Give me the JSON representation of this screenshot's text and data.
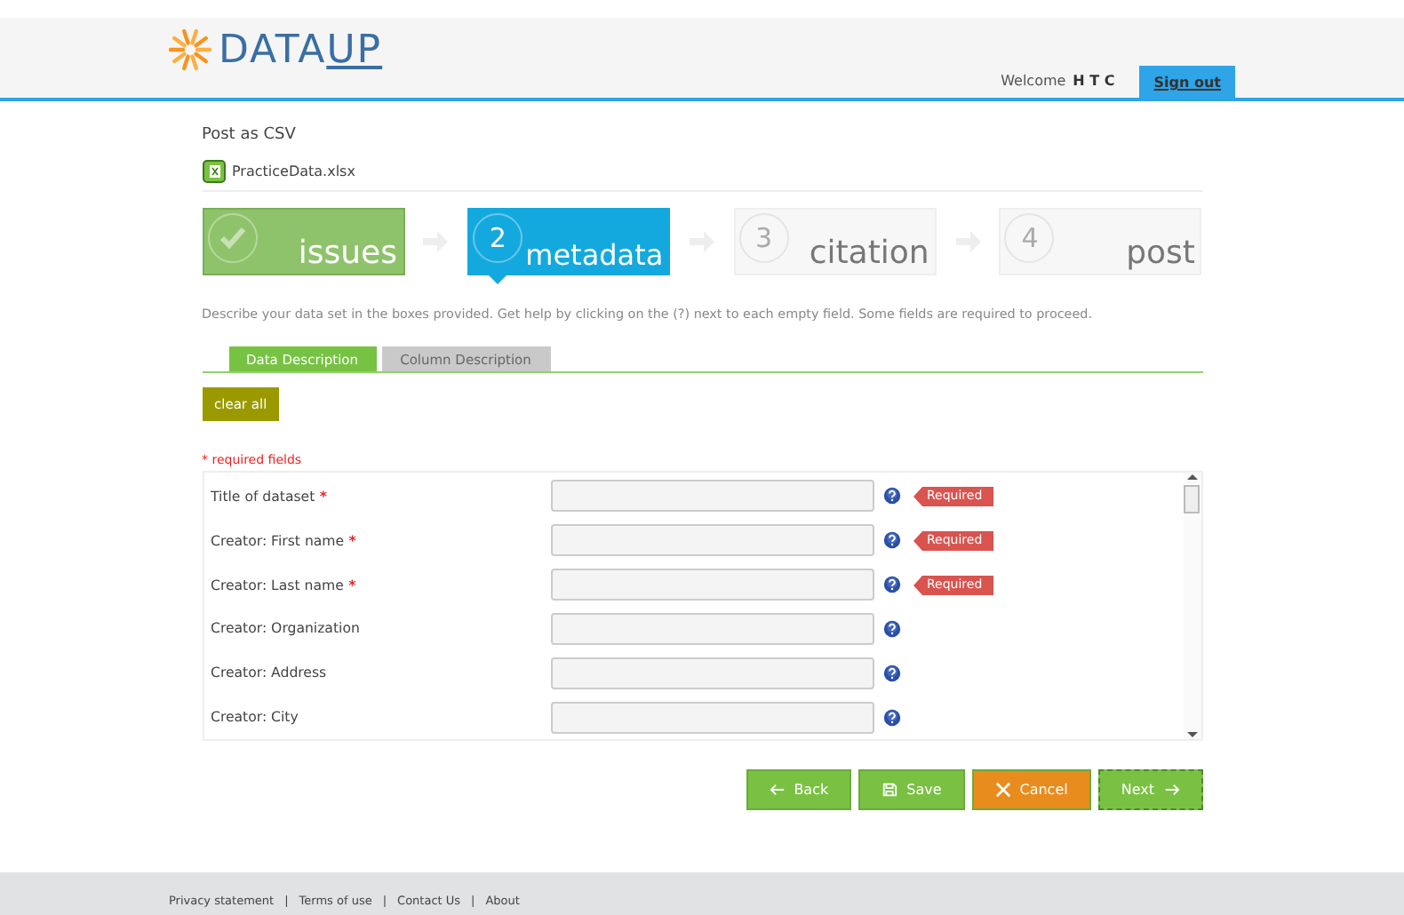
{
  "header": {
    "logo": {
      "text": "DATA",
      "accent": "UP"
    },
    "welcome": "Welcome",
    "user": "H T C",
    "sign_out": "Sign out"
  },
  "page_title": "Post as CSV",
  "file": {
    "name": "PracticeData.xlsx"
  },
  "steps": [
    {
      "label": "issues",
      "done": true,
      "selected": false
    },
    {
      "number": "2",
      "label": "metadata",
      "done": false,
      "selected": true
    },
    {
      "number": "3",
      "label": "citation",
      "done": false,
      "selected": false
    },
    {
      "number": "4",
      "label": "post",
      "done": false,
      "selected": false
    }
  ],
  "description": "Describe your data set in the boxes provided. Get help by clicking on the (?) next to each empty field. Some fields are required to proceed.",
  "tabs": [
    {
      "label": "Data Description",
      "selected": true
    },
    {
      "label": "Column Description",
      "selected": false
    }
  ],
  "clear_button": "clear all",
  "required_note": "* required fields",
  "fields": [
    {
      "label": "Title of dataset",
      "required_mark": "*",
      "badge": "Required"
    },
    {
      "label": "Creator: First name",
      "required_mark": "*",
      "badge": "Required"
    },
    {
      "label": "Creator: Last name",
      "required_mark": "*",
      "badge": "Required"
    },
    {
      "label": "Creator: Organization"
    },
    {
      "label": "Creator: Address"
    },
    {
      "label": "Creator: City"
    }
  ],
  "buttons": [
    {
      "label": "Back",
      "kind": "back"
    },
    {
      "label": "Save",
      "kind": "save"
    },
    {
      "label": "Cancel",
      "kind": "cancel"
    },
    {
      "label": "Next",
      "kind": "next"
    }
  ],
  "footer": [
    {
      "text": "Privacy statement"
    },
    {
      "separator": "|",
      "text": "Terms of use"
    },
    {
      "separator": "|",
      "text": "Contact Us"
    },
    {
      "separator": "|",
      "text": "About"
    }
  ]
}
